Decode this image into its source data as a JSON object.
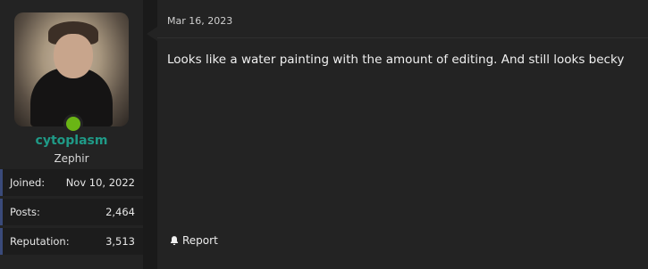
{
  "user": {
    "username": "cytoplasm",
    "title": "Zephir",
    "stats": [
      {
        "label": "Joined:",
        "value": "Nov 10, 2022"
      },
      {
        "label": "Posts:",
        "value": "2,464"
      },
      {
        "label": "Reputation:",
        "value": "3,513"
      }
    ],
    "online_color": "#6ab515",
    "username_color": "#1f9a87"
  },
  "post": {
    "date": "Mar 16, 2023",
    "text": "Looks like a water painting with the amount of editing. And still looks becky",
    "report_label": "Report",
    "report_icon": "bell-icon"
  }
}
